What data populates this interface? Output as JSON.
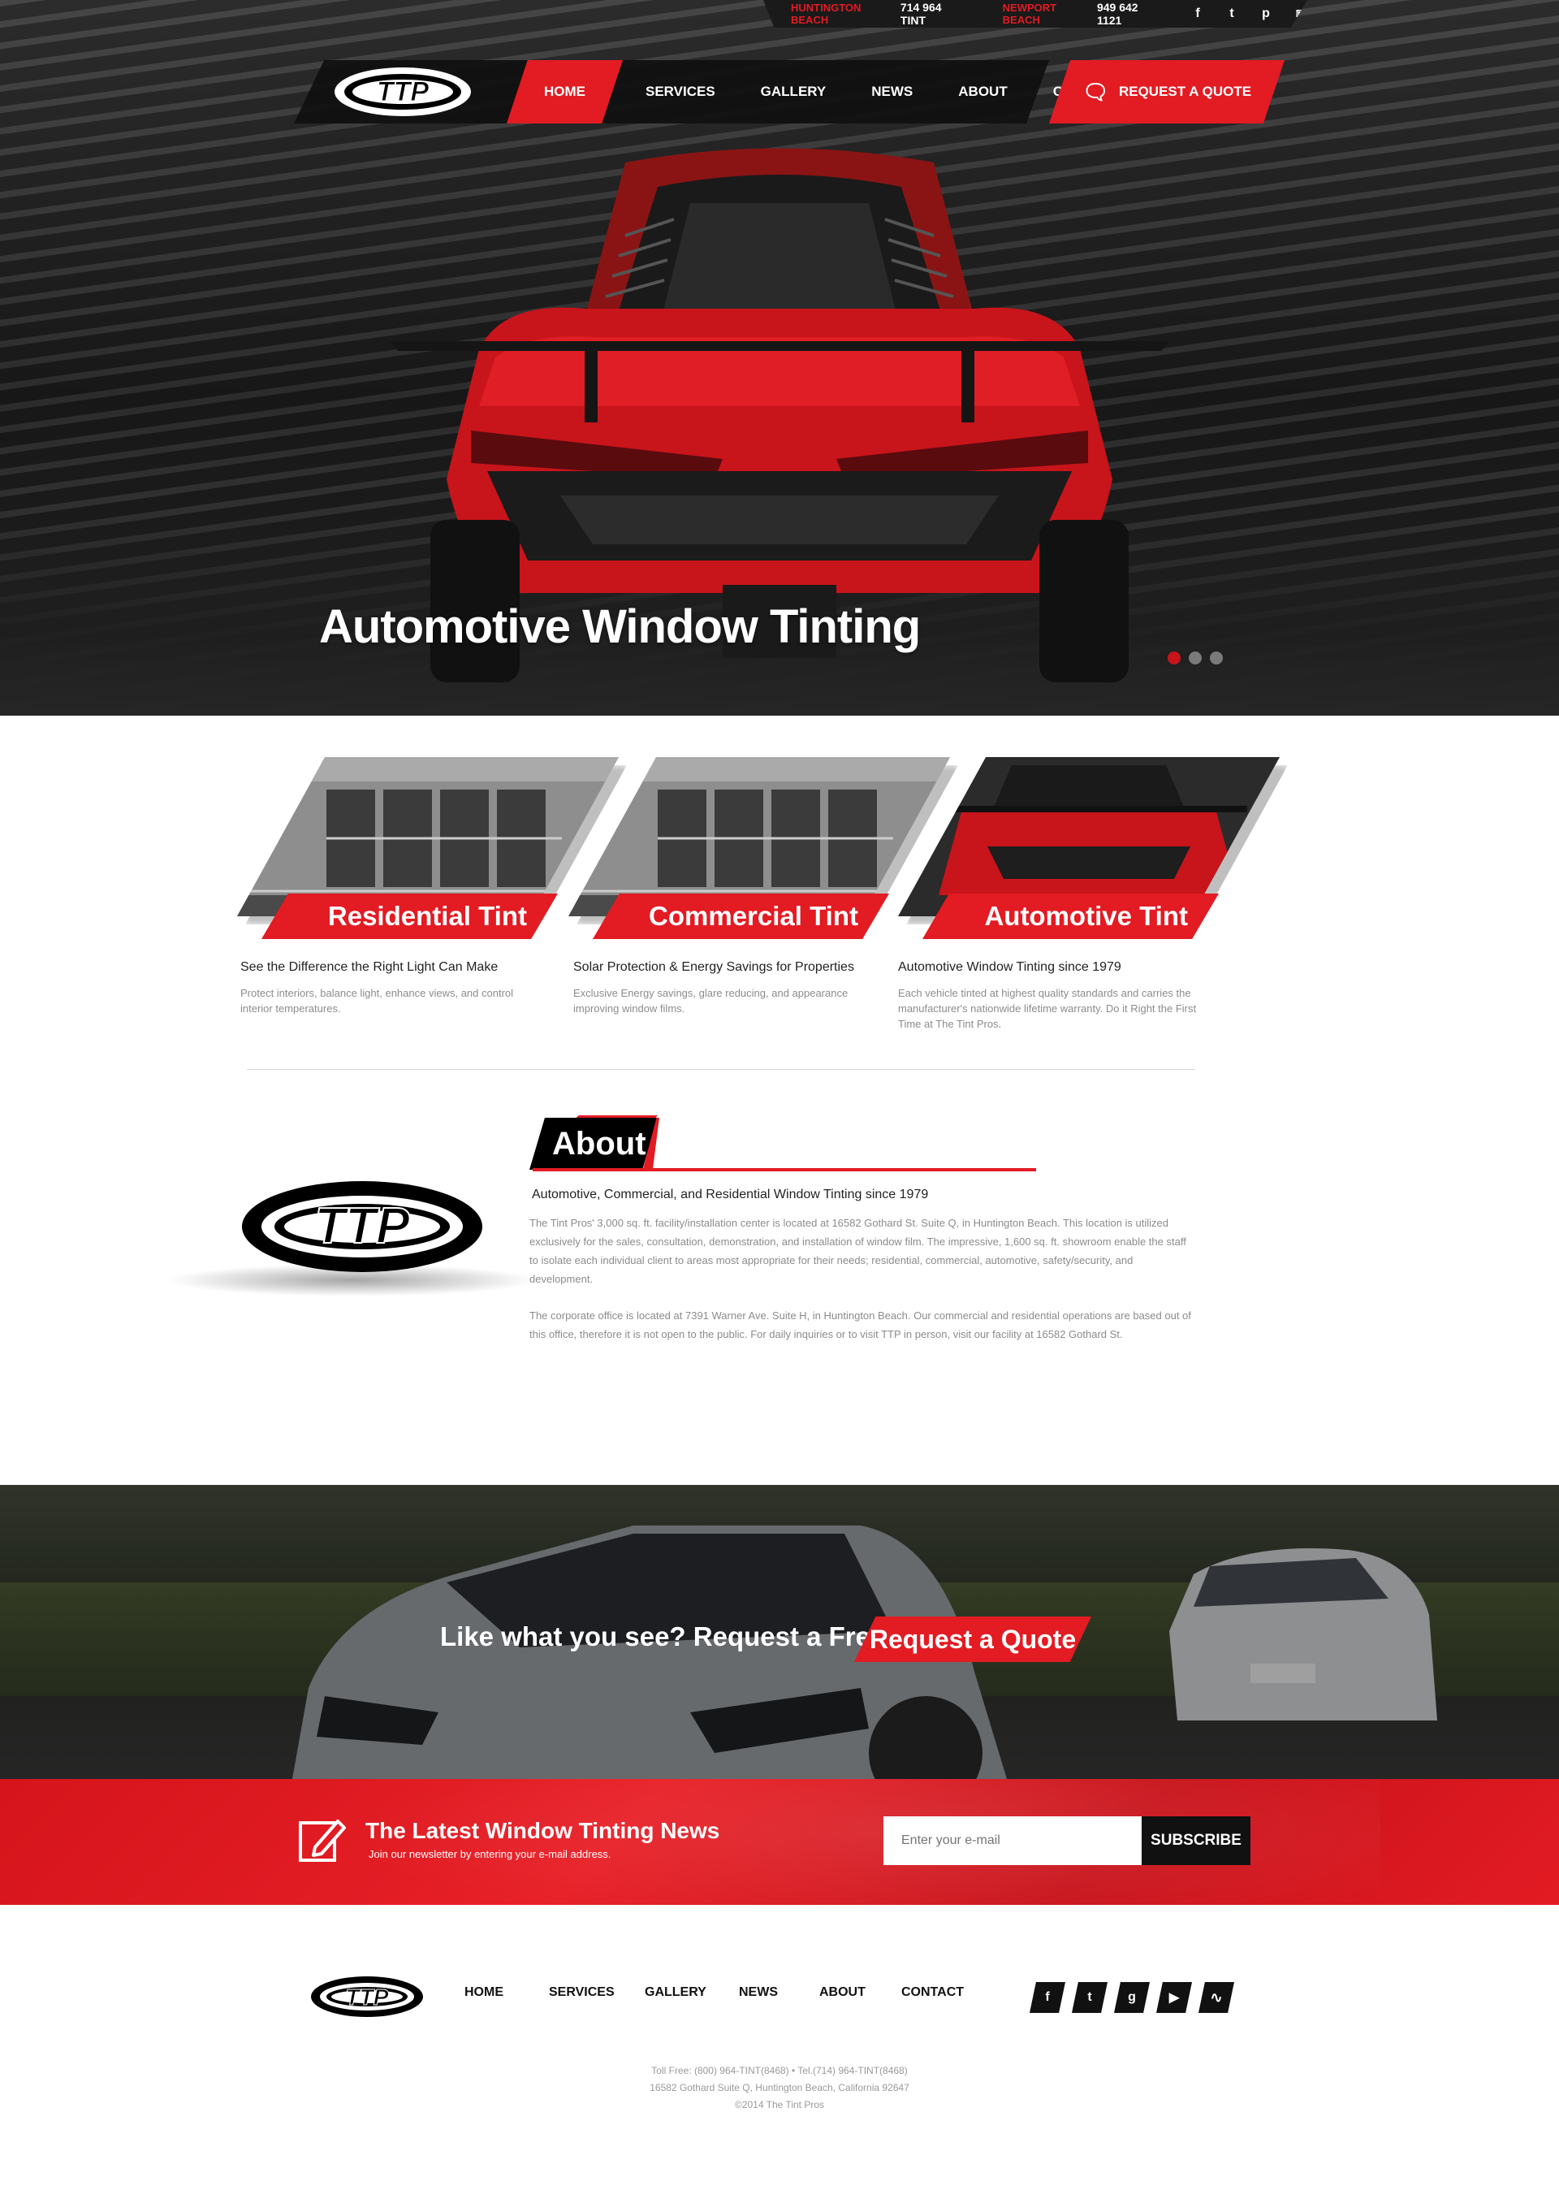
{
  "topbar": {
    "location1": "HUNTINGTON BEACH",
    "phone1": "714 964 TINT",
    "location2": "NEWPORT BEACH",
    "phone2": "949 642 1121",
    "social_icons": [
      "facebook-icon",
      "twitter-icon",
      "pinterest-icon",
      "instagram-icon"
    ]
  },
  "logo": {
    "text": "TTP"
  },
  "nav": {
    "items": [
      "HOME",
      "SERVICES",
      "GALLERY",
      "NEWS",
      "ABOUT",
      "CONTACT"
    ],
    "active": "HOME",
    "quote_label": "REQUEST A QUOTE"
  },
  "hero": {
    "title": "Automotive Window Tinting",
    "slides": 3,
    "active_slide": 1
  },
  "services": [
    {
      "band": "Residential Tint",
      "heading": "See the Difference the Right Light Can Make",
      "text": "Protect interiors, balance light, enhance views, and control interior temperatures."
    },
    {
      "band": "Commercial Tint",
      "heading": "Solar Protection & Energy Savings for Properties",
      "text": "Exclusive Energy savings, glare reducing, and appearance improving window films."
    },
    {
      "band": "Automotive Tint",
      "heading": "Automotive Window Tinting since 1979",
      "text": "Each vehicle tinted at highest quality standards and carries the manufacturer's nationwide lifetime warranty. Do it Right the First Time at The Tint Pros."
    }
  ],
  "about": {
    "title": "About",
    "heading": "Automotive, Commercial, and Residential Window Tinting since 1979",
    "p1": "The Tint Pros' 3,000 sq. ft. facility/installation center is located at 16582 Gothard St. Suite Q, in Huntington Beach. This location is utilized exclusively for the sales, consultation, demonstration, and installation of window film. The impressive, 1,600 sq. ft. showroom enable the staff to isolate each individual client to areas most appropriate for their needs; residential, commercial, automotive, safety/security, and development.",
    "p2": "The corporate office is located at 7391 Warner Ave. Suite H, in Huntington Beach. Our commercial and residential operations are based out of this office, therefore it is not open to the public. For daily inquiries or to visit TTP in person, visit our facility at 16582 Gothard St."
  },
  "cta": {
    "text": "Like what you see? Request a Free Quote.",
    "button": "Request a Quote"
  },
  "newsletter": {
    "title": "The Latest Window Tinting News",
    "subtitle": "Join our newsletter by entering your e-mail address.",
    "placeholder": "Enter your e-mail",
    "button": "SUBSCRIBE"
  },
  "footer": {
    "nav": [
      "HOME",
      "SERVICES",
      "GALLERY",
      "NEWS",
      "ABOUT",
      "CONTACT"
    ],
    "social": [
      "f",
      "t",
      "g",
      "▶",
      "rss"
    ],
    "social_icons": [
      "facebook-icon",
      "twitter-icon",
      "google-plus-icon",
      "youtube-icon",
      "rss-icon"
    ],
    "line1": "Toll Free: (800) 964-TINT(8468) • Tel.(714) 964-TINT(8468)",
    "line2": "16582 Gothard Suite Q, Huntington Beach, California 92647",
    "line3": "©2014 The Tint Pros"
  },
  "colors": {
    "accent": "#e31b23",
    "dark": "#111111"
  }
}
